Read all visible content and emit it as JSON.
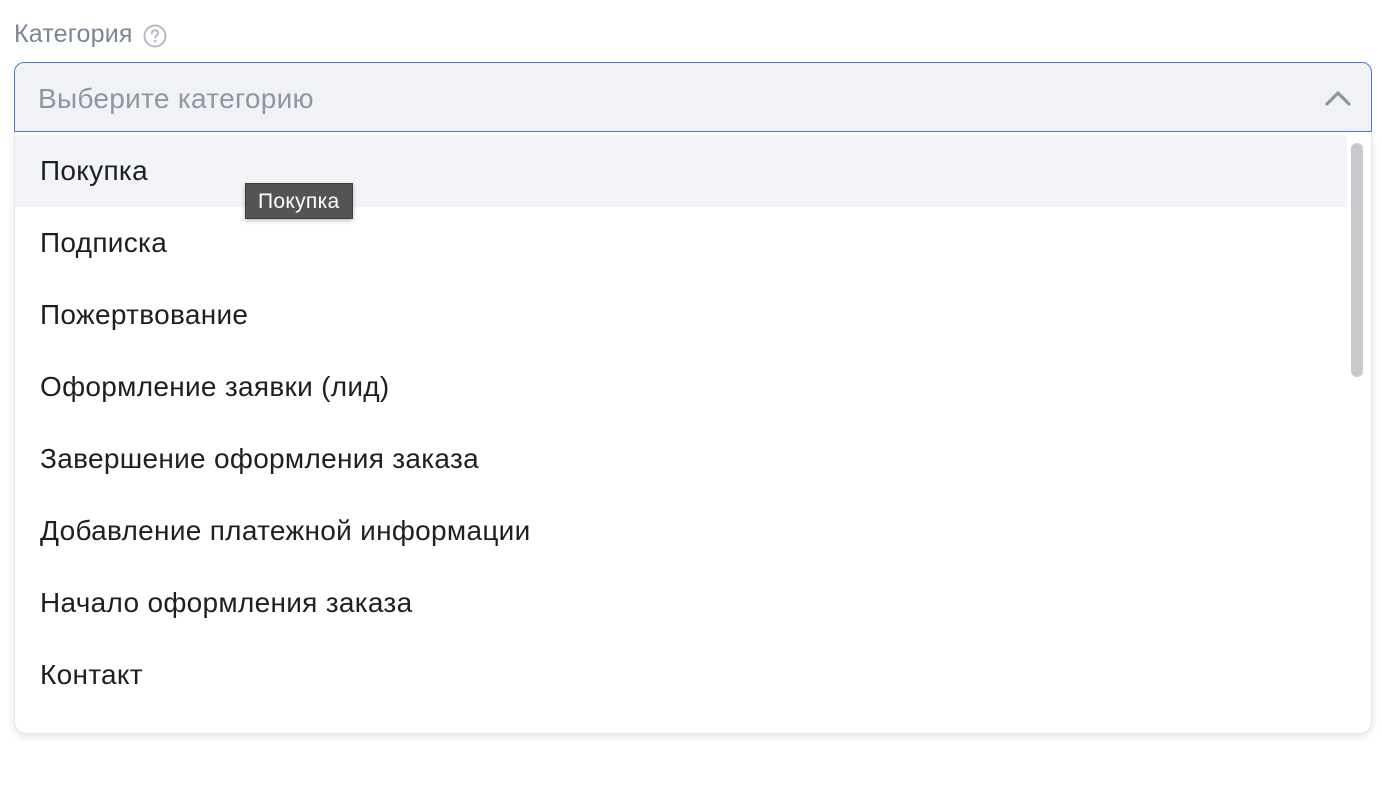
{
  "field": {
    "label": "Категория",
    "help_icon": "question-circle-icon"
  },
  "select": {
    "placeholder": "Выберите категорию",
    "chevron_icon": "chevron-up-icon",
    "expanded": true
  },
  "options": [
    {
      "label": "Покупка",
      "hovered": true
    },
    {
      "label": "Подписка",
      "hovered": false
    },
    {
      "label": "Пожертвование",
      "hovered": false
    },
    {
      "label": "Оформление заявки (лид)",
      "hovered": false
    },
    {
      "label": "Завершение оформления заказа",
      "hovered": false
    },
    {
      "label": "Добавление платежной информации",
      "hovered": false
    },
    {
      "label": "Начало оформления заказа",
      "hovered": false
    },
    {
      "label": "Контакт",
      "hovered": false
    }
  ],
  "tooltip": {
    "text": "Покупка"
  },
  "colors": {
    "focus_border": "#4a7fd0",
    "select_background": "#f1f2f5",
    "hover_background": "#f2f4f7",
    "tooltip_background": "#545454",
    "label_text": "#7b8594",
    "placeholder_text": "#8f96a3",
    "option_text": "#1c1f24"
  }
}
